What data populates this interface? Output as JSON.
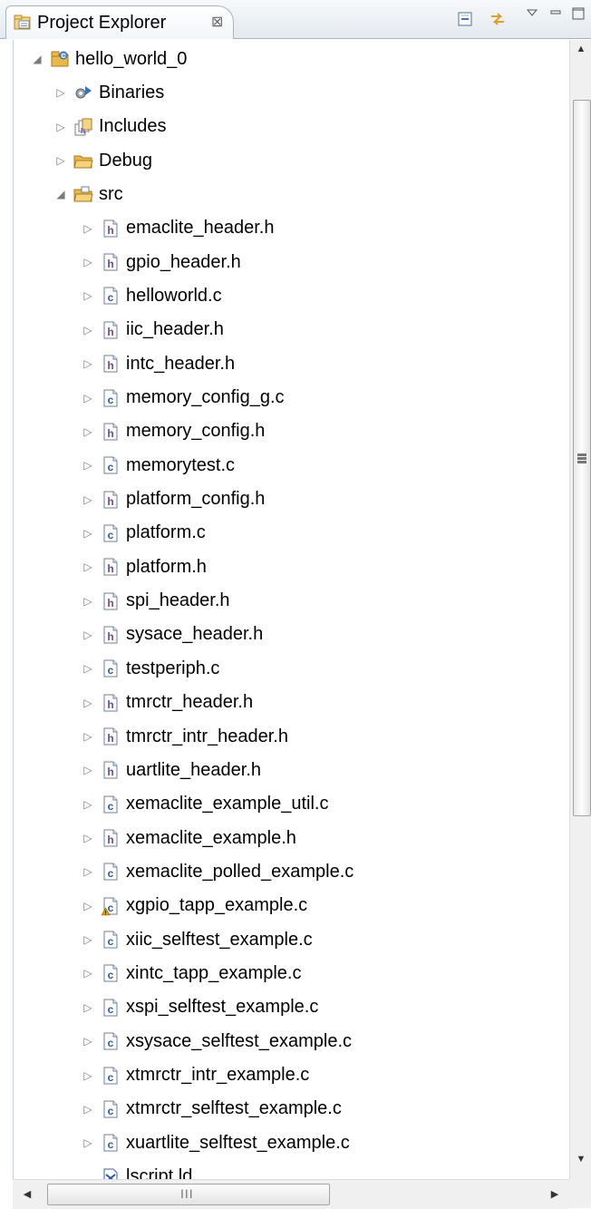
{
  "view": {
    "title": "Project Explorer",
    "close_glyph": "⊠",
    "toolbar": {
      "collapse_all": "collapse-all-icon",
      "link_with_editor": "link-with-editor-icon",
      "view_menu": "view-menu-icon",
      "minimize": "minimize-icon",
      "maximize": "maximize-icon"
    }
  },
  "tree": [
    {
      "label": "hello_world_0",
      "icon": "project",
      "depth": 0,
      "twisty": "open"
    },
    {
      "label": "Binaries",
      "icon": "binaries",
      "depth": 1,
      "twisty": "closed"
    },
    {
      "label": "Includes",
      "icon": "includes",
      "depth": 1,
      "twisty": "closed"
    },
    {
      "label": "Debug",
      "icon": "folder",
      "depth": 1,
      "twisty": "closed"
    },
    {
      "label": "src",
      "icon": "src-folder",
      "depth": 1,
      "twisty": "open"
    },
    {
      "label": "emaclite_header.h",
      "icon": "h-file",
      "depth": 2,
      "twisty": "closed"
    },
    {
      "label": "gpio_header.h",
      "icon": "h-file",
      "depth": 2,
      "twisty": "closed"
    },
    {
      "label": "helloworld.c",
      "icon": "c-file",
      "depth": 2,
      "twisty": "closed"
    },
    {
      "label": "iic_header.h",
      "icon": "h-file",
      "depth": 2,
      "twisty": "closed"
    },
    {
      "label": "intc_header.h",
      "icon": "h-file",
      "depth": 2,
      "twisty": "closed"
    },
    {
      "label": "memory_config_g.c",
      "icon": "c-file",
      "depth": 2,
      "twisty": "closed"
    },
    {
      "label": "memory_config.h",
      "icon": "h-file",
      "depth": 2,
      "twisty": "closed"
    },
    {
      "label": "memorytest.c",
      "icon": "c-file",
      "depth": 2,
      "twisty": "closed"
    },
    {
      "label": "platform_config.h",
      "icon": "h-file",
      "depth": 2,
      "twisty": "closed"
    },
    {
      "label": "platform.c",
      "icon": "c-file",
      "depth": 2,
      "twisty": "closed"
    },
    {
      "label": "platform.h",
      "icon": "h-file",
      "depth": 2,
      "twisty": "closed"
    },
    {
      "label": "spi_header.h",
      "icon": "h-file",
      "depth": 2,
      "twisty": "closed"
    },
    {
      "label": "sysace_header.h",
      "icon": "h-file",
      "depth": 2,
      "twisty": "closed"
    },
    {
      "label": "testperiph.c",
      "icon": "c-file",
      "depth": 2,
      "twisty": "closed"
    },
    {
      "label": "tmrctr_header.h",
      "icon": "h-file",
      "depth": 2,
      "twisty": "closed"
    },
    {
      "label": "tmrctr_intr_header.h",
      "icon": "h-file",
      "depth": 2,
      "twisty": "closed"
    },
    {
      "label": "uartlite_header.h",
      "icon": "h-file",
      "depth": 2,
      "twisty": "closed"
    },
    {
      "label": "xemaclite_example_util.c",
      "icon": "c-file",
      "depth": 2,
      "twisty": "closed"
    },
    {
      "label": "xemaclite_example.h",
      "icon": "h-file",
      "depth": 2,
      "twisty": "closed"
    },
    {
      "label": "xemaclite_polled_example.c",
      "icon": "c-file",
      "depth": 2,
      "twisty": "closed"
    },
    {
      "label": "xgpio_tapp_example.c",
      "icon": "c-file-warning",
      "depth": 2,
      "twisty": "closed"
    },
    {
      "label": "xiic_selftest_example.c",
      "icon": "c-file",
      "depth": 2,
      "twisty": "closed"
    },
    {
      "label": "xintc_tapp_example.c",
      "icon": "c-file",
      "depth": 2,
      "twisty": "closed"
    },
    {
      "label": "xspi_selftest_example.c",
      "icon": "c-file",
      "depth": 2,
      "twisty": "closed"
    },
    {
      "label": "xsysace_selftest_example.c",
      "icon": "c-file",
      "depth": 2,
      "twisty": "closed"
    },
    {
      "label": "xtmrctr_intr_example.c",
      "icon": "c-file",
      "depth": 2,
      "twisty": "closed"
    },
    {
      "label": "xtmrctr_selftest_example.c",
      "icon": "c-file",
      "depth": 2,
      "twisty": "closed"
    },
    {
      "label": "xuartlite_selftest_example.c",
      "icon": "c-file",
      "depth": 2,
      "twisty": "closed"
    },
    {
      "label": "lscript.ld",
      "icon": "linker-script",
      "depth": 2,
      "twisty": "none"
    }
  ],
  "hscroll": {
    "grip": "III"
  },
  "colors": {
    "accent": "#3d6fb6",
    "h_letter": "#6b4aa0",
    "c_letter": "#2a58a8",
    "folder": "#e8b84a",
    "warning": "#e0a000"
  }
}
